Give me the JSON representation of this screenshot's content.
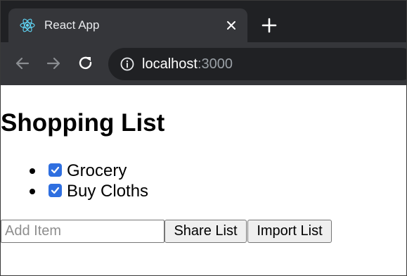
{
  "browser": {
    "tab": {
      "title": "React App",
      "favicon": "react-logo-icon",
      "close_icon": "close-icon"
    },
    "new_tab_icon": "plus-icon",
    "toolbar": {
      "back_icon": "arrow-left-icon",
      "forward_icon": "arrow-right-icon",
      "reload_icon": "reload-icon",
      "site_info_icon": "info-icon",
      "url_host": "localhost",
      "url_port": ":3000"
    }
  },
  "page": {
    "title": "Shopping List",
    "items": [
      {
        "label": "Grocery",
        "checked": true
      },
      {
        "label": "Buy Cloths",
        "checked": true
      }
    ],
    "add_input": {
      "value": "",
      "placeholder": "Add Item"
    },
    "share_button": "Share List",
    "import_button": "Import List"
  },
  "colors": {
    "chrome_dark": "#202124",
    "chrome_tab": "#35363a",
    "checkbox_accent": "#2f6fe0"
  }
}
